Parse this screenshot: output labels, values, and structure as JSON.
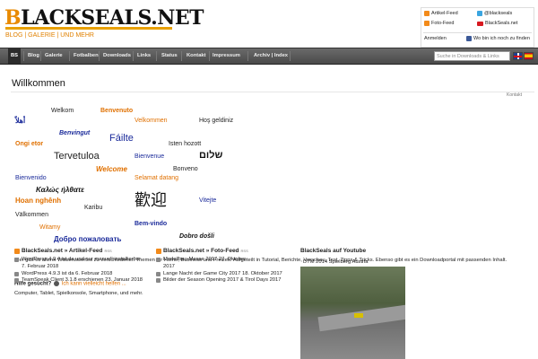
{
  "site": {
    "logo_cap": "B",
    "logo_rest": "LACKSEALS.NET",
    "tagline": "BLOG | GALERIE | UND MEHR"
  },
  "social": {
    "artikel_feed": "Artikel-Feed",
    "foto_feed": "Foto-Feed",
    "twitter": "@blackseals",
    "youtube": "BlackSeals.net",
    "anmelden": "Anmelden",
    "facebook": "Wo bin ich noch zu finden"
  },
  "nav": {
    "items": [
      "BS",
      "Blog",
      "Galerie",
      "Fotbalben",
      "Downloads",
      "Links",
      "Status",
      "Kontakt",
      "Impressum",
      "Archiv | Index"
    ],
    "search_placeholder": "Suche in Downloads & Links"
  },
  "main": {
    "title": "Willkommen",
    "kontakt_small": "Kontakt",
    "cloud": [
      {
        "text": "Welkom",
        "color": "#222",
        "size": "7px",
        "style": "normal",
        "weight": "normal",
        "family": "sans"
      },
      {
        "text": "Benvenuto",
        "color": "#e07000",
        "size": "7px",
        "style": "normal",
        "weight": "bold",
        "family": "sans"
      },
      {
        "text": "أهلاً",
        "color": "#1a2a9a",
        "size": "8px",
        "style": "normal",
        "weight": "bold",
        "family": "sans"
      },
      {
        "text": "Velkommen",
        "color": "#e07000",
        "size": "7px",
        "style": "normal",
        "weight": "normal",
        "family": "sans"
      },
      {
        "text": "Hoş geldiniz",
        "color": "#222",
        "size": "7px",
        "style": "normal",
        "weight": "normal",
        "family": "sans"
      },
      {
        "text": "Benvingut",
        "color": "#1a2a9a",
        "size": "7px",
        "style": "italic",
        "weight": "bold",
        "family": "sans"
      },
      {
        "text": "Fáilte",
        "color": "#1a2a9a",
        "size": "11px",
        "style": "normal",
        "weight": "normal",
        "family": "sans"
      },
      {
        "text": "Ongi etor",
        "color": "#e07000",
        "size": "7px",
        "style": "normal",
        "weight": "bold",
        "family": "sans"
      },
      {
        "text": "Isten hozott",
        "color": "#222",
        "size": "7px",
        "style": "normal",
        "weight": "normal",
        "family": "sans"
      },
      {
        "text": "Tervetuloa",
        "color": "#222",
        "size": "11px",
        "style": "normal",
        "weight": "normal",
        "family": "sans"
      },
      {
        "text": "Bienvenue",
        "color": "#1a2a9a",
        "size": "7px",
        "style": "normal",
        "weight": "normal",
        "family": "sans"
      },
      {
        "text": "שלום",
        "color": "#111",
        "size": "11px",
        "style": "normal",
        "weight": "bold",
        "family": "sans"
      },
      {
        "text": "Welcome",
        "color": "#e07000",
        "size": "8px",
        "style": "italic",
        "weight": "bold",
        "family": "sans"
      },
      {
        "text": "Bonveno",
        "color": "#222",
        "size": "7px",
        "style": "normal",
        "weight": "normal",
        "family": "sans"
      },
      {
        "text": "Bienvenido",
        "color": "#1a2a9a",
        "size": "7px",
        "style": "normal",
        "weight": "normal",
        "family": "sans"
      },
      {
        "text": "Selamat datang",
        "color": "#e07000",
        "size": "7px",
        "style": "normal",
        "weight": "normal",
        "family": "sans"
      },
      {
        "text": "Καλώς ήλθατε",
        "color": "#111",
        "size": "8px",
        "style": "italic",
        "weight": "bold",
        "family": "sans"
      },
      {
        "text": "歡迎",
        "color": "#111",
        "size": "18px",
        "style": "normal",
        "weight": "normal",
        "family": "sans"
      },
      {
        "text": "Vitejte",
        "color": "#1a2a9a",
        "size": "7px",
        "style": "normal",
        "weight": "normal",
        "family": "sans"
      },
      {
        "text": "Hoan nghênh",
        "color": "#e07000",
        "size": "8px",
        "style": "normal",
        "weight": "bold",
        "family": "sans"
      },
      {
        "text": "Karibu",
        "color": "#222",
        "size": "7px",
        "style": "normal",
        "weight": "normal",
        "family": "sans"
      },
      {
        "text": "Välkommen",
        "color": "#222",
        "size": "7px",
        "style": "normal",
        "weight": "normal",
        "family": "sans"
      },
      {
        "text": "Bem-vindo",
        "color": "#1a2a9a",
        "size": "7px",
        "style": "normal",
        "weight": "bold",
        "family": "sans"
      },
      {
        "text": "Witamy",
        "color": "#e07000",
        "size": "7px",
        "style": "normal",
        "weight": "normal",
        "family": "sans"
      },
      {
        "text": "Dobro došli",
        "color": "#111",
        "size": "7px",
        "style": "italic",
        "weight": "bold",
        "family": "sans"
      },
      {
        "text": "Добро пожаловать",
        "color": "#1a2a9a",
        "size": "8px",
        "style": "normal",
        "weight": "bold",
        "family": "sans"
      }
    ],
    "intro": "Hier gibt es allerei Wissenswertes zu verschiedenen Themen für Home, Business und Freizeit. Aufgeteilt in Tutorial, Berichte, Vorschau, Test, Tipps & Tricks. Ebenso gibt es ein Downloadportal mit passenden Inhalt.",
    "help_label": "Hilfe gesucht?",
    "help_link": "Ich kann vielleicht helfen ...",
    "devices": "Computer, Tablet, Spielkonsole, Smartphone, und mehr."
  },
  "feeds": {
    "artikel": {
      "title": "BlackSeals.net » Artikel-Feed",
      "items": [
        "WordPress 4.9.4 ist da und nur manuell installierbar",
        "7. Februar 2018",
        "WordPress 4.9.3 ist da 6. Februar 2018",
        "TeamSpeak Client 3.1.8 erschienen 23. Januar 2018"
      ]
    },
    "foto": {
      "title": "BlackSeals.net » Foto-Feed",
      "items": [
        "Modellbau-Messe 2017 27. Oktober",
        "2017",
        "Lange Nacht der Game City 2017 18. Oktober 2017",
        "Bilder der Season Opening 2017 & Tirol Days 2017"
      ]
    },
    "youtube": {
      "title": "BlackSeals auf Youtube",
      "video_title": "DTM 2014 Spielberg Austria"
    }
  },
  "colors": {
    "accent": "#e88a00",
    "nav_bg": "#555555",
    "link_blue": "#1a2a9a"
  }
}
